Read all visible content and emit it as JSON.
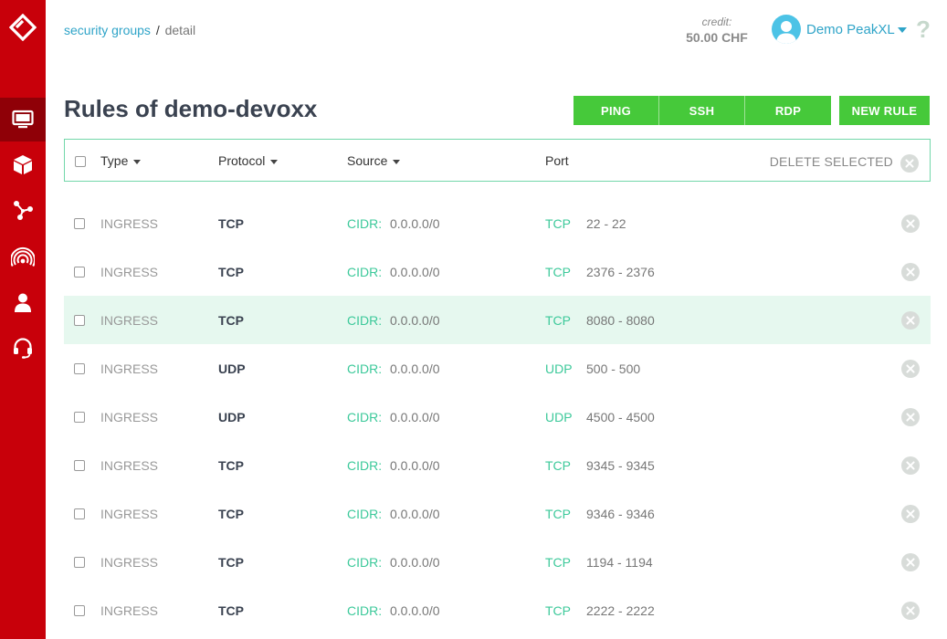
{
  "sidebar": {
    "items": [
      {
        "icon": "monitor-icon",
        "active": true
      },
      {
        "icon": "cube-icon",
        "active": false
      },
      {
        "icon": "network-icon",
        "active": false
      },
      {
        "icon": "signal-icon",
        "active": false
      },
      {
        "icon": "user-icon",
        "active": false
      },
      {
        "icon": "headset-icon",
        "active": false
      }
    ]
  },
  "header": {
    "breadcrumb": {
      "link": "security groups",
      "separator": "/",
      "current": "detail"
    },
    "credit": {
      "label": "credit:",
      "value": "50.00 CHF"
    },
    "user": {
      "name": "Demo PeakXL"
    },
    "help": "?"
  },
  "page": {
    "title": "Rules of demo-devoxx",
    "buttons": {
      "ping": "PING",
      "ssh": "SSH",
      "rdp": "RDP",
      "new_rule": "NEW RULE"
    }
  },
  "table": {
    "headers": {
      "type": "Type",
      "protocol": "Protocol",
      "source": "Source",
      "port": "Port"
    },
    "delete_selected": "DELETE SELECTED",
    "rows": [
      {
        "type": "INGRESS",
        "protocol": "TCP",
        "source_label": "CIDR:",
        "source": "0.0.0.0/0",
        "port_protocol": "TCP",
        "port_range": "22 - 22"
      },
      {
        "type": "INGRESS",
        "protocol": "TCP",
        "source_label": "CIDR:",
        "source": "0.0.0.0/0",
        "port_protocol": "TCP",
        "port_range": "2376 - 2376"
      },
      {
        "type": "INGRESS",
        "protocol": "TCP",
        "source_label": "CIDR:",
        "source": "0.0.0.0/0",
        "port_protocol": "TCP",
        "port_range": "8080 - 8080"
      },
      {
        "type": "INGRESS",
        "protocol": "UDP",
        "source_label": "CIDR:",
        "source": "0.0.0.0/0",
        "port_protocol": "UDP",
        "port_range": "500 - 500"
      },
      {
        "type": "INGRESS",
        "protocol": "UDP",
        "source_label": "CIDR:",
        "source": "0.0.0.0/0",
        "port_protocol": "UDP",
        "port_range": "4500 - 4500"
      },
      {
        "type": "INGRESS",
        "protocol": "TCP",
        "source_label": "CIDR:",
        "source": "0.0.0.0/0",
        "port_protocol": "TCP",
        "port_range": "9345 - 9345"
      },
      {
        "type": "INGRESS",
        "protocol": "TCP",
        "source_label": "CIDR:",
        "source": "0.0.0.0/0",
        "port_protocol": "TCP",
        "port_range": "9346 - 9346"
      },
      {
        "type": "INGRESS",
        "protocol": "TCP",
        "source_label": "CIDR:",
        "source": "0.0.0.0/0",
        "port_protocol": "TCP",
        "port_range": "1194 - 1194"
      },
      {
        "type": "INGRESS",
        "protocol": "TCP",
        "source_label": "CIDR:",
        "source": "0.0.0.0/0",
        "port_protocol": "TCP",
        "port_range": "2222 - 2222"
      }
    ]
  },
  "colors": {
    "brand_red": "#c8000a",
    "active_red": "#8f0007",
    "button_green": "#46c93a",
    "accent_teal": "#3cc99a",
    "link_blue": "#2fa4c8",
    "row_highlight": "#e6f8ef"
  }
}
